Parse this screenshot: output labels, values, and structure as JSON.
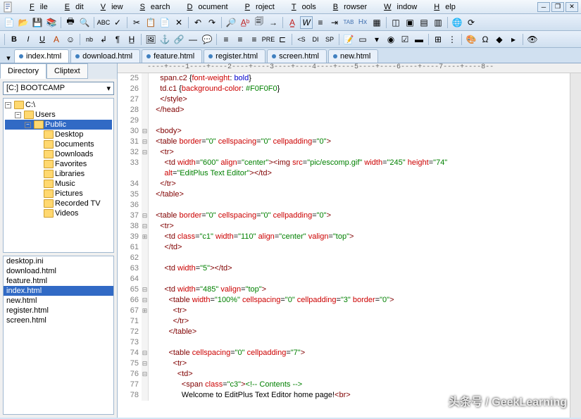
{
  "menu": [
    "File",
    "Edit",
    "View",
    "Search",
    "Document",
    "Project",
    "Tools",
    "Browser",
    "Window",
    "Help"
  ],
  "tabs": [
    {
      "label": "index.html",
      "active": true
    },
    {
      "label": "download.html"
    },
    {
      "label": "feature.html"
    },
    {
      "label": "register.html"
    },
    {
      "label": "screen.html"
    },
    {
      "label": "new.html"
    }
  ],
  "sidebar": {
    "tabs": [
      "Directory",
      "Cliptext"
    ],
    "drive": "[C:] BOOTCAMP",
    "tree": [
      {
        "label": "C:\\",
        "indent": 0,
        "exp": "-"
      },
      {
        "label": "Users",
        "indent": 1,
        "exp": "-"
      },
      {
        "label": "Public",
        "indent": 2,
        "exp": "-",
        "sel": true
      },
      {
        "label": "Desktop",
        "indent": 3
      },
      {
        "label": "Documents",
        "indent": 3
      },
      {
        "label": "Downloads",
        "indent": 3
      },
      {
        "label": "Favorites",
        "indent": 3
      },
      {
        "label": "Libraries",
        "indent": 3
      },
      {
        "label": "Music",
        "indent": 3
      },
      {
        "label": "Pictures",
        "indent": 3
      },
      {
        "label": "Recorded TV",
        "indent": 3
      },
      {
        "label": "Videos",
        "indent": 3
      }
    ],
    "files": [
      "desktop.ini",
      "download.html",
      "feature.html",
      "index.html",
      "new.html",
      "register.html",
      "screen.html"
    ],
    "selectedFile": "index.html"
  },
  "ruler": "----+----1----+----2----+----3----+----4----+----5----+----6----+----7----+----8--",
  "code": [
    {
      "n": 25,
      "html": "    <span class='sel-css'>span.c2</span> {<span class='attr'>font-weight</span>: <span class='kw'>bold</span>}"
    },
    {
      "n": 26,
      "html": "    <span class='sel-css'>td.c1</span> {<span class='attr'>background-color</span>: <span class='str'>#F0F0F0</span>}"
    },
    {
      "n": 27,
      "html": "    <span class='tag'>&lt;/style&gt;</span>"
    },
    {
      "n": 28,
      "html": "  <span class='tag'>&lt;/head&gt;</span>"
    },
    {
      "n": 29,
      "html": ""
    },
    {
      "n": 30,
      "fm": "⊟",
      "html": "  <span class='tag'>&lt;body&gt;</span>"
    },
    {
      "n": 31,
      "fm": "⊟",
      "html": "  <span class='tag'>&lt;table</span> <span class='attr'>border</span>=<span class='val'>\"0\"</span> <span class='attr'>cellspacing</span>=<span class='val'>\"0\"</span> <span class='attr'>cellpadding</span>=<span class='val'>\"0\"</span><span class='tag'>&gt;</span>"
    },
    {
      "n": 32,
      "fm": "⊟",
      "html": "    <span class='tag'>&lt;tr&gt;</span>"
    },
    {
      "n": 33,
      "html": "      <span class='tag'>&lt;td</span> <span class='attr'>width</span>=<span class='val'>\"600\"</span> <span class='attr'>align</span>=<span class='val'>\"center\"</span><span class='tag'>&gt;&lt;img</span> <span class='attr'>src</span>=<span class='val'>\"pic/escomp.gif\"</span> <span class='attr'>width</span>=<span class='val'>\"245\"</span> <span class='attr'>height</span>=<span class='val'>\"74\"</span>"
    },
    {
      "n": "",
      "html": "      <span class='attr'>alt</span>=<span class='val'>\"EditPlus Text Editor\"</span><span class='tag'>&gt;&lt;/td&gt;</span>"
    },
    {
      "n": 34,
      "html": "    <span class='tag'>&lt;/tr&gt;</span>"
    },
    {
      "n": 35,
      "html": "  <span class='tag'>&lt;/table&gt;</span>"
    },
    {
      "n": 36,
      "html": ""
    },
    {
      "n": 37,
      "fm": "⊟",
      "html": "  <span class='tag'>&lt;table</span> <span class='attr'>border</span>=<span class='val'>\"0\"</span> <span class='attr'>cellspacing</span>=<span class='val'>\"0\"</span> <span class='attr'>cellpadding</span>=<span class='val'>\"0\"</span><span class='tag'>&gt;</span>"
    },
    {
      "n": 38,
      "fm": "⊟",
      "html": "    <span class='tag'>&lt;tr&gt;</span>"
    },
    {
      "n": 39,
      "fm": "⊞",
      "html": "      <span class='tag'>&lt;td</span> <span class='attr'>class</span>=<span class='val'>\"c1\"</span> <span class='attr'>width</span>=<span class='val'>\"110\"</span> <span class='attr'>align</span>=<span class='val'>\"center\"</span> <span class='attr'>valign</span>=<span class='val'>\"top\"</span><span class='tag'>&gt;</span>"
    },
    {
      "n": 61,
      "html": "      <span class='tag'>&lt;/td&gt;</span>"
    },
    {
      "n": 62,
      "html": ""
    },
    {
      "n": 63,
      "html": "      <span class='tag'>&lt;td</span> <span class='attr'>width</span>=<span class='val'>\"5\"</span><span class='tag'>&gt;&lt;/td&gt;</span>"
    },
    {
      "n": 64,
      "html": ""
    },
    {
      "n": 65,
      "fm": "⊟",
      "html": "      <span class='tag'>&lt;td</span> <span class='attr'>width</span>=<span class='val'>\"485\"</span> <span class='attr'>valign</span>=<span class='val'>\"top\"</span><span class='tag'>&gt;</span>"
    },
    {
      "n": 66,
      "fm": "⊟",
      "html": "        <span class='tag'>&lt;table</span> <span class='attr'>width</span>=<span class='val'>\"100%\"</span> <span class='attr'>cellspacing</span>=<span class='val'>\"0\"</span> <span class='attr'>cellpadding</span>=<span class='val'>\"3\"</span> <span class='attr'>border</span>=<span class='val'>\"0\"</span><span class='tag'>&gt;</span>"
    },
    {
      "n": 67,
      "fm": "⊞",
      "html": "          <span class='tag'>&lt;tr&gt;</span>"
    },
    {
      "n": 71,
      "html": "          <span class='tag'>&lt;/tr&gt;</span>"
    },
    {
      "n": 72,
      "html": "        <span class='tag'>&lt;/table&gt;</span>"
    },
    {
      "n": 73,
      "html": ""
    },
    {
      "n": 74,
      "fm": "⊟",
      "html": "        <span class='tag'>&lt;table</span> <span class='attr'>cellspacing</span>=<span class='val'>\"0\"</span> <span class='attr'>cellpadding</span>=<span class='val'>\"7\"</span><span class='tag'>&gt;</span>"
    },
    {
      "n": 75,
      "fm": "⊟",
      "html": "          <span class='tag'>&lt;tr&gt;</span>"
    },
    {
      "n": 76,
      "fm": "⊟",
      "html": "            <span class='tag'>&lt;td&gt;</span>"
    },
    {
      "n": 77,
      "html": "              <span class='tag'>&lt;span</span> <span class='attr'>class</span>=<span class='val'>\"c3\"</span><span class='tag'>&gt;</span><span class='cmt'>&lt;!-- Contents --&gt;</span>"
    },
    {
      "n": 78,
      "html": "              Welcome to EditPlus Text Editor home page!<span class='tag'>&lt;br&gt;</span>"
    }
  ],
  "watermark": "头条号 / GeekLearning"
}
